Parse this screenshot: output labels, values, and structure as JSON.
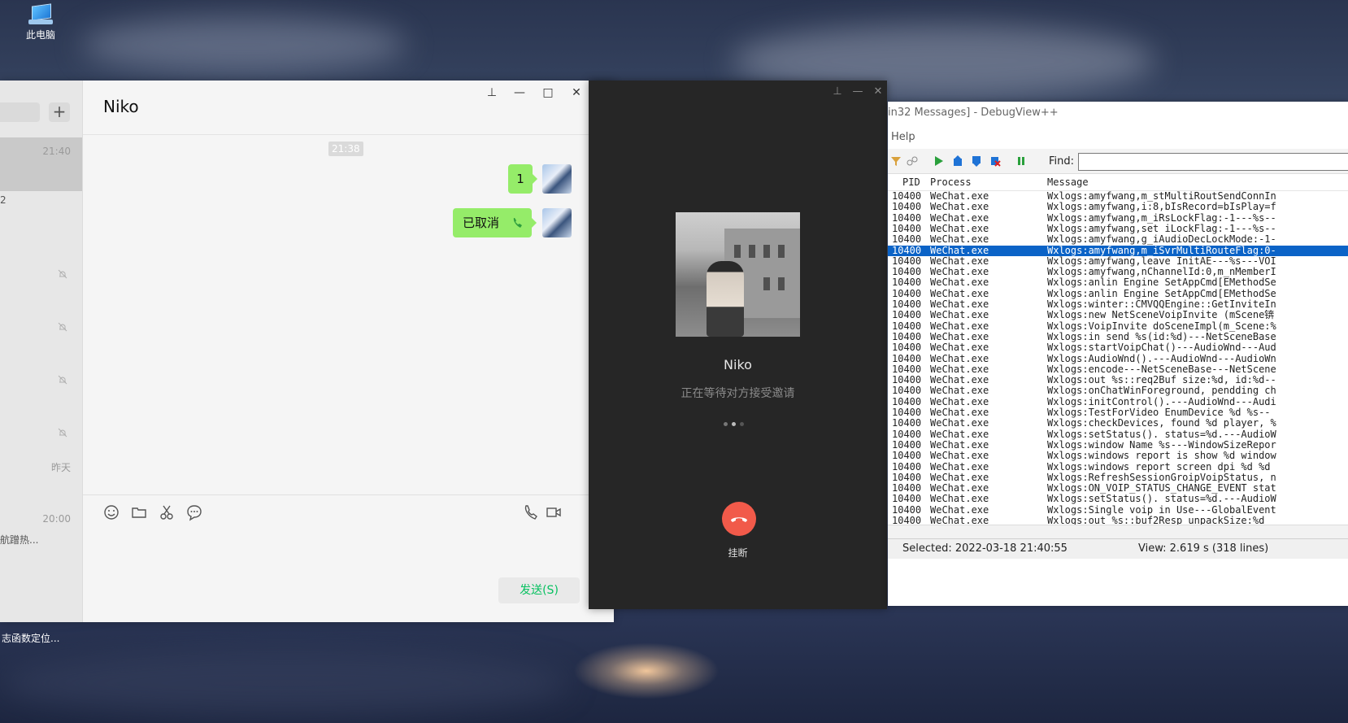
{
  "desktop": {
    "this_pc_label": "此电脑",
    "left_caption": "志函数定位..."
  },
  "wechat": {
    "chat_title": "Niko",
    "sidebar": {
      "selected_time": "21:40",
      "selected_snippet": "2",
      "yesterday_label": "昨天",
      "time_2000": "20:00",
      "snippet_2000": "航蹭热..."
    },
    "controls": {
      "pin": "⊥",
      "minimize": "—",
      "maximize": "□",
      "close": "✕",
      "more": "···"
    },
    "time_chip": "21:38",
    "messages": [
      {
        "text": "1"
      },
      {
        "text": "已取消"
      }
    ],
    "send_label": "发送(S)"
  },
  "call": {
    "name": "Niko",
    "status": "正在等待对方接受邀请",
    "hangup_label": "挂断",
    "controls": {
      "pin": "⊥",
      "minimize": "—",
      "close": "✕"
    }
  },
  "debugview": {
    "title": "in32 Messages] - DebugView++",
    "menu_help": "Help",
    "find_label": "Find:",
    "find_value": "",
    "columns": {
      "pid": "PID",
      "process": "Process",
      "message": "Message"
    },
    "rows": [
      {
        "pid": "10400",
        "process": "WeChat.exe",
        "message": "Wxlogs:amyfwang,m_stMultiRoutSendConnIn"
      },
      {
        "pid": "10400",
        "process": "WeChat.exe",
        "message": "Wxlogs:amyfwang,i:8,bIsRecord=bIsPlay=f"
      },
      {
        "pid": "10400",
        "process": "WeChat.exe",
        "message": "Wxlogs:amyfwang,m_iRsLockFlag:-1---%s--"
      },
      {
        "pid": "10400",
        "process": "WeChat.exe",
        "message": "Wxlogs:amyfwang,set iLockFlag:-1---%s--"
      },
      {
        "pid": "10400",
        "process": "WeChat.exe",
        "message": "Wxlogs:amyfwang,g_iAudioDecLockMode:-1-"
      },
      {
        "pid": "10400",
        "process": "WeChat.exe",
        "message": "Wxlogs:amyfwang,m_iSvrMultiRouteFlag:0-"
      },
      {
        "pid": "10400",
        "process": "WeChat.exe",
        "message": "Wxlogs:amyfwang,leave InitAE---%s---VOI"
      },
      {
        "pid": "10400",
        "process": "WeChat.exe",
        "message": "Wxlogs:amyfwang,nChannelId:0,m_nMemberI"
      },
      {
        "pid": "10400",
        "process": "WeChat.exe",
        "message": "Wxlogs:anlin Engine SetAppCmd[EMethodSe"
      },
      {
        "pid": "10400",
        "process": "WeChat.exe",
        "message": "Wxlogs:anlin Engine SetAppCmd[EMethodSe"
      },
      {
        "pid": "10400",
        "process": "WeChat.exe",
        "message": "Wxlogs:winter::CMVQQEngine::GetInviteIn"
      },
      {
        "pid": "10400",
        "process": "WeChat.exe",
        "message": "Wxlogs:new NetSceneVoipInvite (mScene锛"
      },
      {
        "pid": "10400",
        "process": "WeChat.exe",
        "message": "Wxlogs:VoipInvite doSceneImpl(m_Scene:%"
      },
      {
        "pid": "10400",
        "process": "WeChat.exe",
        "message": "Wxlogs:in send %s(id:%d)---NetSceneBase"
      },
      {
        "pid": "10400",
        "process": "WeChat.exe",
        "message": "Wxlogs:startVoipChat()---AudioWnd---Aud"
      },
      {
        "pid": "10400",
        "process": "WeChat.exe",
        "message": "Wxlogs:AudioWnd().---AudioWnd---AudioWn"
      },
      {
        "pid": "10400",
        "process": "WeChat.exe",
        "message": "Wxlogs:encode---NetSceneBase---NetScene"
      },
      {
        "pid": "10400",
        "process": "WeChat.exe",
        "message": "Wxlogs:out %s::req2Buf size:%d, id:%d--"
      },
      {
        "pid": "10400",
        "process": "WeChat.exe",
        "message": "Wxlogs:onChatWinForeground, pendding ch"
      },
      {
        "pid": "10400",
        "process": "WeChat.exe",
        "message": "Wxlogs:initControl().---AudioWnd---Audi"
      },
      {
        "pid": "10400",
        "process": "WeChat.exe",
        "message": "Wxlogs:TestForVideo EnumDevice %d  %s--"
      },
      {
        "pid": "10400",
        "process": "WeChat.exe",
        "message": "Wxlogs:checkDevices, found %d player, %"
      },
      {
        "pid": "10400",
        "process": "WeChat.exe",
        "message": "Wxlogs:setStatus(). status=%d.---AudioW"
      },
      {
        "pid": "10400",
        "process": "WeChat.exe",
        "message": "Wxlogs:window Name %s---WindowSizeRepor"
      },
      {
        "pid": "10400",
        "process": "WeChat.exe",
        "message": "Wxlogs:windows report is show %d window"
      },
      {
        "pid": "10400",
        "process": "WeChat.exe",
        "message": "Wxlogs:windows report screen dpi %d %d "
      },
      {
        "pid": "10400",
        "process": "WeChat.exe",
        "message": "Wxlogs:RefreshSessionGroipVoipStatus, n"
      },
      {
        "pid": "10400",
        "process": "WeChat.exe",
        "message": "Wxlogs:ON_VOIP_STATUS_CHANGE_EVENT stat"
      },
      {
        "pid": "10400",
        "process": "WeChat.exe",
        "message": "Wxlogs:setStatus(). status=%d.---AudioW"
      },
      {
        "pid": "10400",
        "process": "WeChat.exe",
        "message": "Wxlogs:Single voip in Use---GlobalEvent"
      },
      {
        "pid": "10400",
        "process": "WeChat.exe",
        "message": "Wxlogs:out %s::buf2Resp unpackSize:%d"
      }
    ],
    "selected_row": 5,
    "status": {
      "selected": "Selected: 2022-03-18 21:40:55",
      "view": "View: 2.619 s (318 lines)"
    }
  }
}
